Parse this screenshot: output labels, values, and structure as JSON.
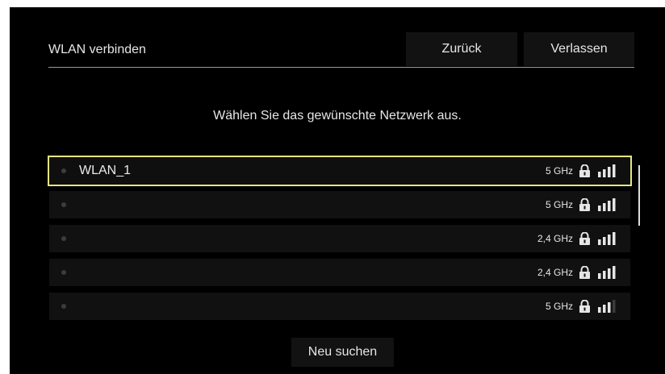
{
  "header": {
    "title": "WLAN verbinden",
    "back_label": "Zurück",
    "exit_label": "Verlassen"
  },
  "prompt": "Wählen Sie das gewünschte Netzwerk aus.",
  "networks": [
    {
      "ssid": "WLAN_1",
      "band": "5 GHz",
      "secured": true,
      "signal_bars": 4,
      "selected": true
    },
    {
      "ssid": "",
      "band": "5 GHz",
      "secured": true,
      "signal_bars": 4,
      "selected": false
    },
    {
      "ssid": "",
      "band": "2,4 GHz",
      "secured": true,
      "signal_bars": 4,
      "selected": false
    },
    {
      "ssid": "",
      "band": "2,4 GHz",
      "secured": true,
      "signal_bars": 4,
      "selected": false
    },
    {
      "ssid": "",
      "band": "5 GHz",
      "secured": true,
      "signal_bars": 3,
      "selected": false
    }
  ],
  "rescan_label": "Neu suchen",
  "colors": {
    "background": "#000000",
    "selection_border": "#e6e680",
    "text": "#e6e6e6"
  },
  "icons": [
    "lock-icon",
    "wifi-signal-icon"
  ]
}
